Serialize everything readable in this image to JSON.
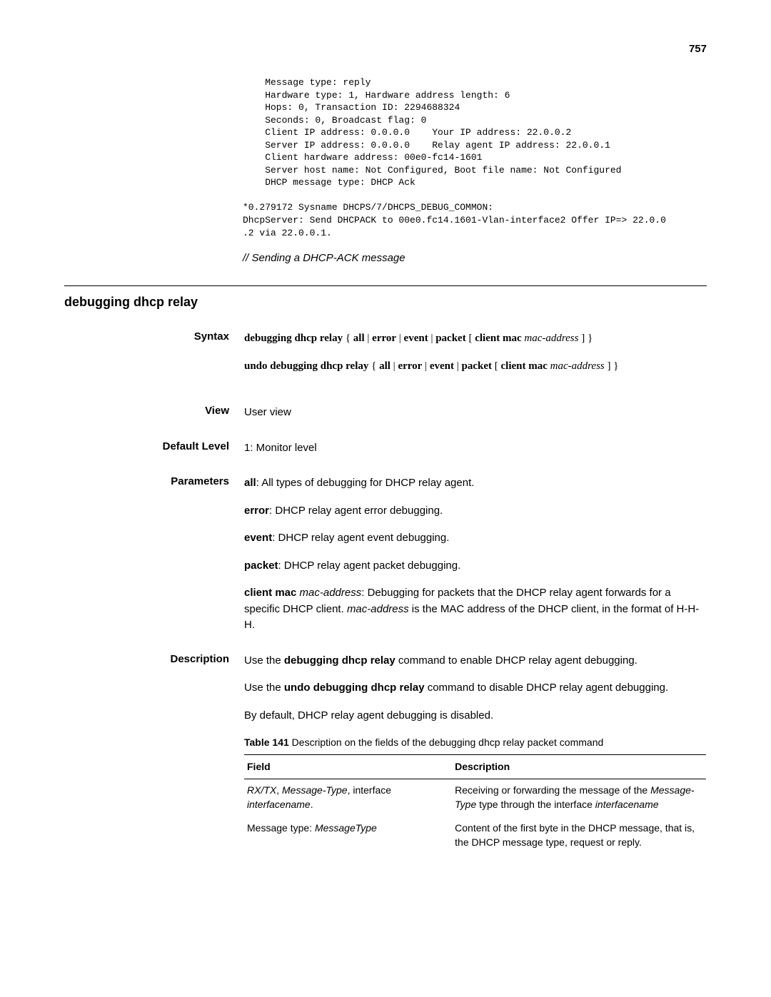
{
  "page_number": "757",
  "code": {
    "lines": [
      "    Message type: reply",
      "    Hardware type: 1, Hardware address length: 6",
      "    Hops: 0, Transaction ID: 2294688324",
      "    Seconds: 0, Broadcast flag: 0",
      "    Client IP address: 0.0.0.0    Your IP address: 22.0.0.2",
      "    Server IP address: 0.0.0.0    Relay agent IP address: 22.0.0.1",
      "    Client hardware address: 00e0-fc14-1601",
      "    Server host name: Not Configured, Boot file name: Not Configured",
      "    DHCP message type: DHCP Ack",
      "",
      "*0.279172 Sysname DHCPS/7/DHCPS_DEBUG_COMMON:",
      "DhcpServer: Send DHCPACK to 00e0.fc14.1601-Vlan-interface2 Offer IP=> 22.0.0",
      ".2 via 22.0.0.1."
    ]
  },
  "comment": "// Sending a DHCP-ACK message",
  "section_title": "debugging dhcp relay",
  "labels": {
    "syntax": "Syntax",
    "view": "View",
    "deflevel": "Default Level",
    "params": "Parameters",
    "desc": "Description"
  },
  "syntax": {
    "line1": {
      "cmd": "debugging dhcp relay",
      "open": " { ",
      "all": "all",
      "sep": " | ",
      "error": "error",
      "event": "event",
      "packet": "packet",
      "sub_open": " [ ",
      "clientmac": "client mac",
      "arg": " mac-address",
      "close": " ] }"
    },
    "line2": {
      "cmd": "undo debugging dhcp relay",
      "open": " { ",
      "all": "all",
      "sep": " | ",
      "error": "error",
      "event": "event",
      "packet": "packet",
      "sub_open": " [ ",
      "clientmac": "client mac",
      "arg": " mac-address",
      "close": " ] }"
    }
  },
  "view": "User view",
  "default_level": "1: Monitor level",
  "params": {
    "all_k": "all",
    "all_v": ": All types of debugging for DHCP relay agent.",
    "error_k": "error",
    "error_v": ": DHCP relay agent error debugging.",
    "event_k": "event",
    "event_v": ": DHCP relay agent event debugging.",
    "packet_k": "packet",
    "packet_v": ": DHCP relay agent packet debugging.",
    "cm_k": "client mac",
    "cm_arg": " mac-address",
    "cm_mid1": ": Debugging for packets that the DHCP relay agent forwards for a specific DHCP client. ",
    "cm_arg2": "mac-address",
    "cm_mid2": " is the MAC address of the DHCP client, in the format of H-H-H."
  },
  "description": {
    "l1a": "Use the ",
    "l1b": "debugging dhcp relay",
    "l1c": " command to enable DHCP relay agent debugging.",
    "l2a": "Use the ",
    "l2b": "undo debugging dhcp relay",
    "l2c": " command to disable DHCP relay agent debugging.",
    "l3": "By default, DHCP relay agent debugging is disabled."
  },
  "table": {
    "cap_b": "Table 141",
    "cap_t": "   Description on the fields of the debugging dhcp relay packet command",
    "hdr_field": "Field",
    "hdr_desc": "Description",
    "r1": {
      "f_a": "RX/TX",
      "f_b": ", ",
      "f_c": "Message-Type",
      "f_d": ", interface ",
      "f_e": "interfacename",
      "f_f": ".",
      "d_a": "Receiving or forwarding the message of the ",
      "d_b": "Message-Type",
      "d_c": " type through the interface ",
      "d_d": "interfacename"
    },
    "r2": {
      "f_a": "Message type: ",
      "f_b": "MessageType",
      "d": "Content of the first byte in the DHCP message, that is, the DHCP message type, request or reply."
    }
  }
}
